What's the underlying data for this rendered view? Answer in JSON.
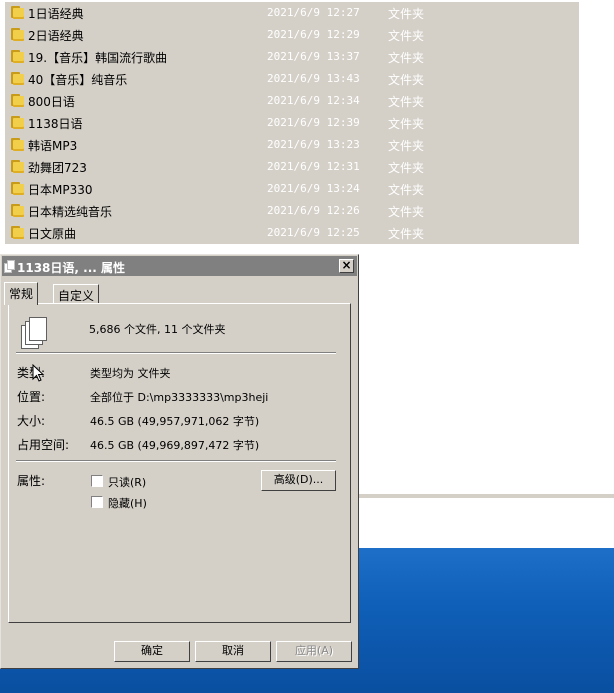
{
  "files": [
    {
      "name": "1日语经典",
      "date": "2021/6/9 12:27",
      "type": "文件夹"
    },
    {
      "name": "2日语经典",
      "date": "2021/6/9 12:29",
      "type": "文件夹"
    },
    {
      "name": "19.【音乐】韩国流行歌曲",
      "date": "2021/6/9 13:37",
      "type": "文件夹"
    },
    {
      "name": "40【音乐】纯音乐",
      "date": "2021/6/9 13:43",
      "type": "文件夹"
    },
    {
      "name": "800日语",
      "date": "2021/6/9 12:34",
      "type": "文件夹"
    },
    {
      "name": "1138日语",
      "date": "2021/6/9 12:39",
      "type": "文件夹"
    },
    {
      "name": "韩语MP3",
      "date": "2021/6/9 13:23",
      "type": "文件夹"
    },
    {
      "name": "劲舞团723",
      "date": "2021/6/9 12:31",
      "type": "文件夹"
    },
    {
      "name": "日本MP330",
      "date": "2021/6/9 13:24",
      "type": "文件夹"
    },
    {
      "name": "日本精选纯音乐",
      "date": "2021/6/9 12:26",
      "type": "文件夹"
    },
    {
      "name": "日文原曲",
      "date": "2021/6/9 12:25",
      "type": "文件夹"
    }
  ],
  "dialog": {
    "title": "1138日语, ... 属性",
    "close_label": "×",
    "tabs": [
      "常规",
      "自定义"
    ],
    "summary": "5,686 个文件, 11 个文件夹",
    "type_label": "类型:",
    "type_value": "类型均为 文件夹",
    "location_label": "位置:",
    "location_value": "全部位于 D:\\mp3333333\\mp3heji",
    "size_label": "大小:",
    "size_value": "46.5 GB (49,957,971,062 字节)",
    "disk_label": "占用空间:",
    "disk_value": "46.5 GB (49,969,897,472 字节)",
    "attr_label": "属性:",
    "readonly_label": "只读(R)",
    "hidden_label": "隐藏(H)",
    "advanced_label": "高级(D)...",
    "ok_label": "确定",
    "cancel_label": "取消",
    "apply_label": "应用(A)"
  }
}
